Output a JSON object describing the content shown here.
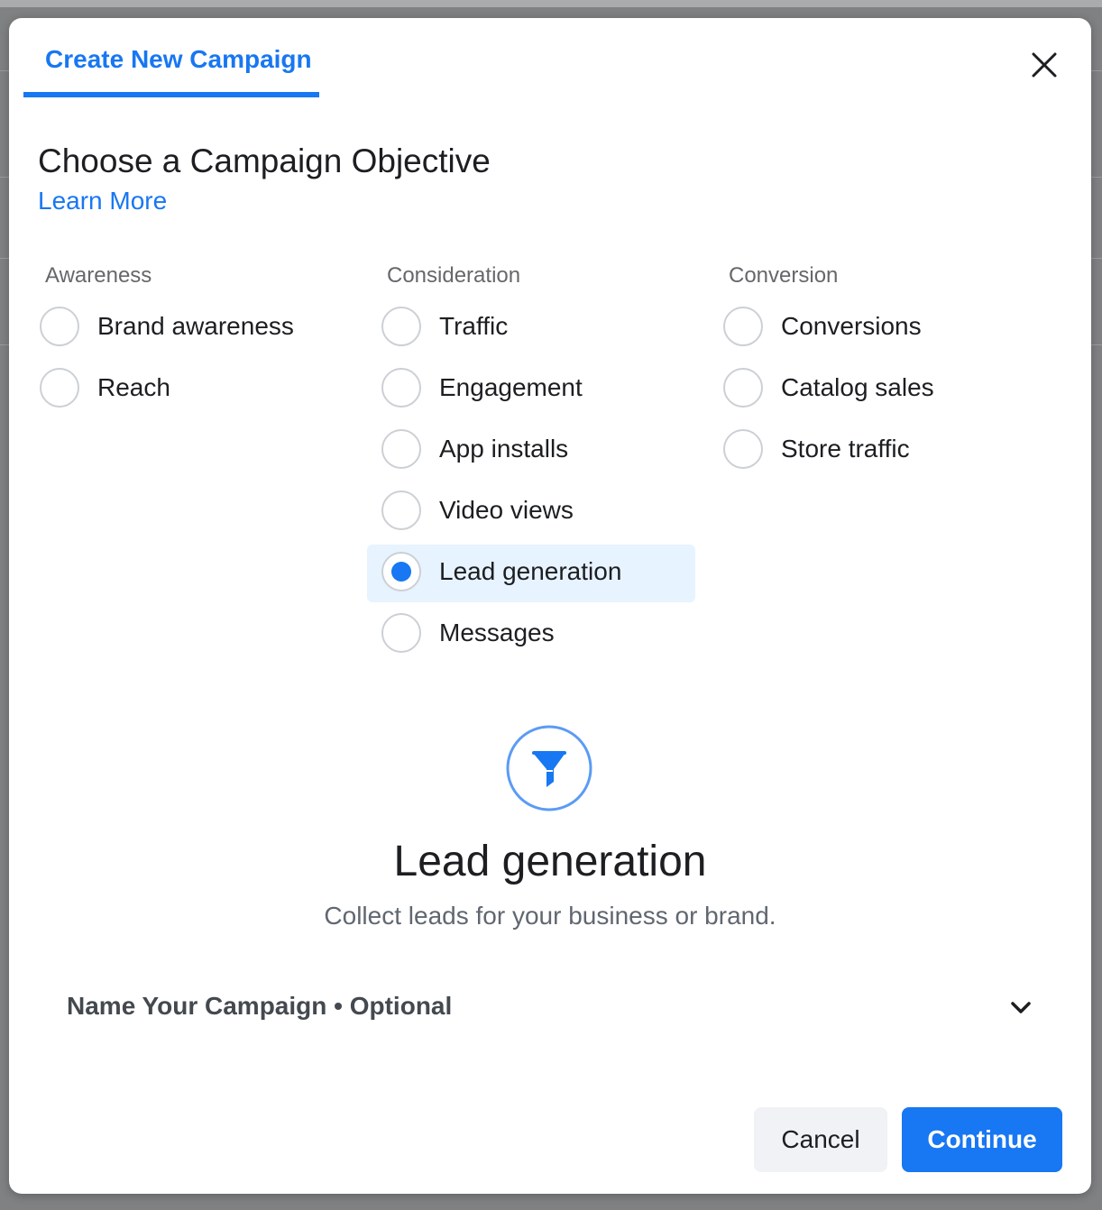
{
  "modal": {
    "tab_label": "Create New Campaign",
    "title": "Choose a Campaign Objective",
    "learn_more": "Learn More"
  },
  "columns": [
    {
      "header": "Awareness",
      "options": [
        "Brand awareness",
        "Reach"
      ]
    },
    {
      "header": "Consideration",
      "options": [
        "Traffic",
        "Engagement",
        "App installs",
        "Video views",
        "Lead generation",
        "Messages"
      ]
    },
    {
      "header": "Conversion",
      "options": [
        "Conversions",
        "Catalog sales",
        "Store traffic"
      ]
    }
  ],
  "selected_option": "Lead generation",
  "detail": {
    "icon": "funnel-icon",
    "title": "Lead generation",
    "description": "Collect leads for your business or brand."
  },
  "name_section": {
    "label": "Name Your Campaign • Optional",
    "icon": "chevron-down-icon"
  },
  "buttons": {
    "cancel": "Cancel",
    "continue": "Continue"
  },
  "colors": {
    "accent": "#1877f2",
    "selected_bg": "#e7f3ff",
    "text": "#1c1e21",
    "muted": "#65676b"
  }
}
